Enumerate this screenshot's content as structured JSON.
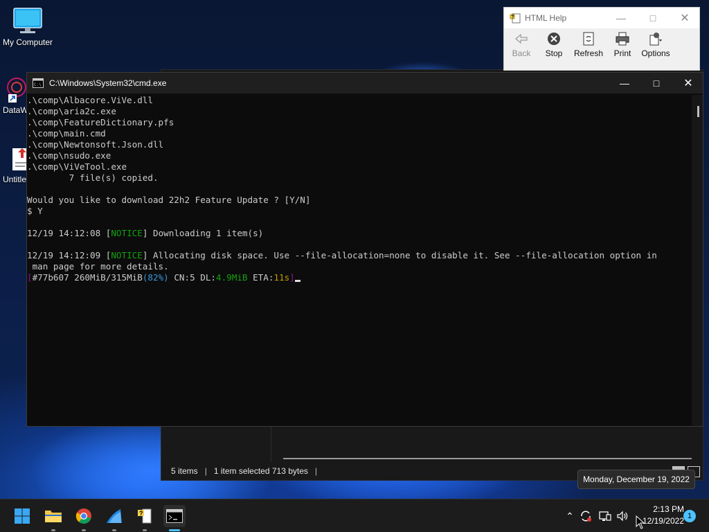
{
  "desktop": {
    "icons": [
      {
        "label": "My Computer"
      },
      {
        "label": "DataW"
      },
      {
        "label": "Untitle"
      }
    ]
  },
  "explorer": {
    "status": {
      "items": "5 items",
      "selected": "1 item selected  713 bytes"
    }
  },
  "help_window": {
    "title": "HTML Help",
    "toolbar": {
      "back": "Back",
      "stop": "Stop",
      "refresh": "Refresh",
      "print": "Print",
      "options": "Options"
    }
  },
  "cmd": {
    "title": "C:\\Windows\\System32\\cmd.exe",
    "lines": [
      ".\\comp\\Albacore.ViVe.dll",
      ".\\comp\\aria2c.exe",
      ".\\comp\\FeatureDictionary.pfs",
      ".\\comp\\main.cmd",
      ".\\comp\\Newtonsoft.Json.dll",
      ".\\comp\\nsudo.exe",
      ".\\comp\\ViVeTool.exe",
      "        7 file(s) copied.",
      "",
      "Would you like to download 22h2 Feature Update ? [Y/N]",
      "$ Y",
      ""
    ],
    "notice1": {
      "time": "12/19 14:12:08",
      "tag": "NOTICE",
      "text": " Downloading 1 item(s)"
    },
    "notice2": {
      "time": "12/19 14:12:09",
      "tag": "NOTICE",
      "text": " Allocating disk space. Use --file-allocation=none to disable it. See --file-allocation option in",
      "cont": " man page for more details."
    },
    "progress": {
      "gid": "#77b607",
      "size": " 260MiB/315MiB",
      "pct": "(82%)",
      "cn": " CN:5 DL:",
      "dl": "4.9MiB",
      "eta_label": " ETA:",
      "eta": "11s"
    }
  },
  "tooltip": {
    "text": "Monday, December 19, 2022"
  },
  "taskbar": {
    "clock_time": "2:13 PM",
    "clock_date": "12/19/2022",
    "notifications": "1"
  },
  "colors": {
    "terminal_green": "#13a10e",
    "terminal_cyan": "#3a96dd",
    "terminal_yellow": "#c19c00",
    "accent": "#4cc2ff"
  }
}
